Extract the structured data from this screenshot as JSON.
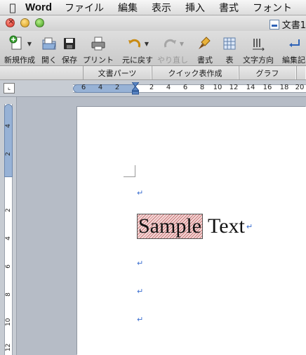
{
  "menubar": {
    "apple_icon": "apple-icon",
    "app_name": "Word",
    "items": [
      "ファイル",
      "編集",
      "表示",
      "挿入",
      "書式",
      "フォント"
    ]
  },
  "window": {
    "title": "文書1"
  },
  "toolbar": {
    "new": "新規作成",
    "open": "開く",
    "save": "保存",
    "print": "プリント",
    "undo": "元に戻す",
    "redo": "やり直し",
    "format": "書式",
    "table": "表",
    "text_direction": "文字方向",
    "edit": "編集記"
  },
  "gallery": {
    "tabs": [
      "文書パーツ",
      "クイック表作成",
      "グラフ"
    ]
  },
  "hruler": {
    "numbers": [
      "6",
      "4",
      "2",
      "2",
      "4",
      "6",
      "8",
      "10",
      "12",
      "14",
      "16",
      "18",
      "20"
    ]
  },
  "vruler": {
    "numbers": [
      "4",
      "2",
      "2",
      "4",
      "6",
      "8",
      "10",
      "12"
    ]
  },
  "document": {
    "selected_text": "Sample",
    "text": " Text",
    "paragraph_mark": "↵"
  },
  "colors": {
    "paragraph_mark": "#3c6fd0",
    "ruler_margin": "#97b2d6"
  }
}
